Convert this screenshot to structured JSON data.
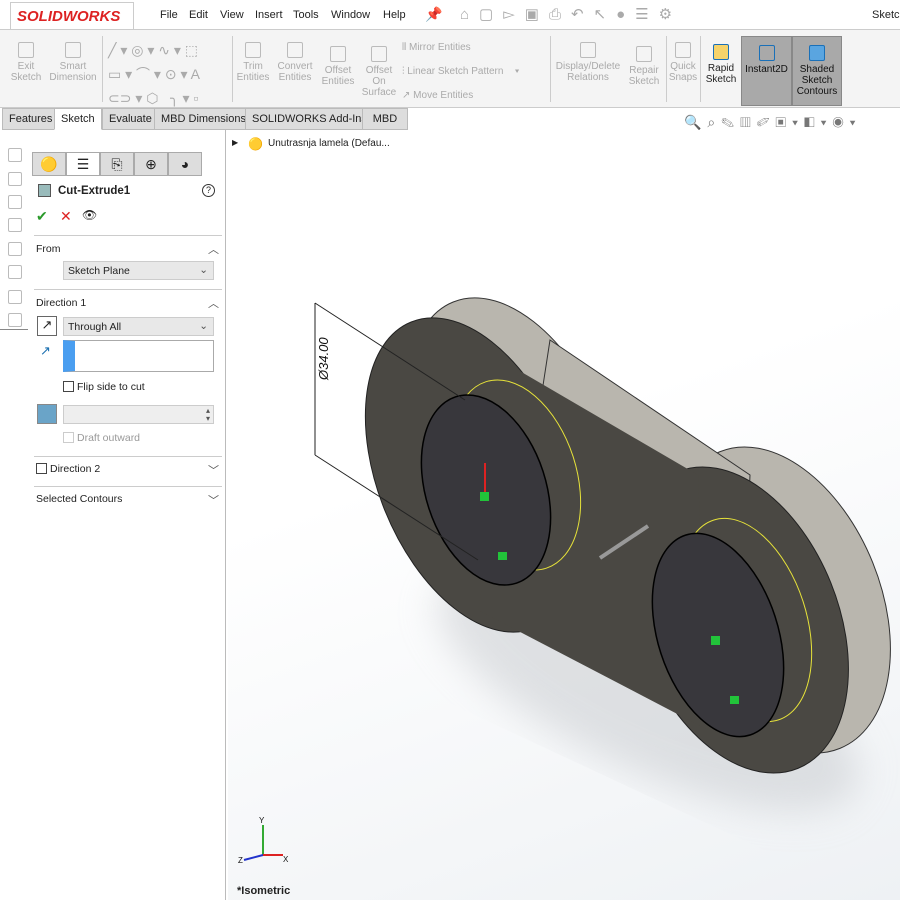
{
  "app": {
    "logo": "SOLIDWORKS",
    "right_label": "Sketch"
  },
  "menu": [
    "File",
    "Edit",
    "View",
    "Insert",
    "Tools",
    "Window",
    "Help"
  ],
  "ribbon": {
    "exit_sketch": "Exit Sketch",
    "smart_dimension": "Smart Dimension",
    "trim": "Trim Entities",
    "convert": "Convert Entities",
    "offset": "Offset Entities",
    "offset_surface": "Offset On Surface",
    "mirror": "Mirror Entities",
    "linear_pattern": "Linear Sketch Pattern",
    "move": "Move Entities",
    "display_delete": "Display/Delete Relations",
    "repair": "Repair Sketch",
    "quick_snaps": "Quick Snaps",
    "rapid_sketch": "Rapid Sketch",
    "instant2d": "Instant2D",
    "shaded": "Shaded Sketch Contours"
  },
  "tabs": [
    "Features",
    "Sketch",
    "Evaluate",
    "MBD Dimensions",
    "SOLIDWORKS Add-Ins",
    "MBD"
  ],
  "panel": {
    "title": "Cut-Extrude1",
    "help": "?",
    "ok": "✔",
    "cancel": "✕",
    "preview": "👁",
    "from_label": "From",
    "from_value": "Sketch Plane",
    "dir1_label": "Direction 1",
    "dir1_value": "Through All",
    "depth_value": "",
    "flip_label": "Flip side to cut",
    "draft_label": "Draft outward",
    "dir2_label": "Direction 2",
    "contours_label": "Selected Contours"
  },
  "viewport": {
    "tree_item": "Unutrasnja lamela  (Defau...",
    "dimension": "Ø34.00",
    "view_name": "*Isometric",
    "axes": {
      "x": "X",
      "y": "Y",
      "z": "Z"
    }
  },
  "colors": {
    "part_face": "#4a4843",
    "part_side": "#b9b6ae",
    "sketch": "#e6e23a",
    "relation": "#22c33a",
    "active_tool": "#a9a9a9"
  }
}
